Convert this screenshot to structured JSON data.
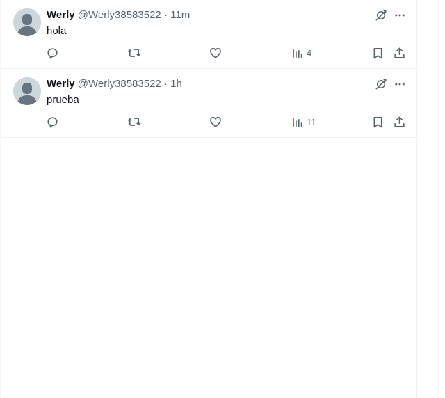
{
  "posts": [
    {
      "author_name": "Werly",
      "author_handle": "@Werly38583522",
      "separator": "·",
      "time": "11m",
      "text": "hola",
      "views_count": "4",
      "icons": {
        "avatar": "default-avatar",
        "grok": "grok-icon",
        "more": "more-icon",
        "reply": "reply-icon",
        "repost": "repost-icon",
        "like": "heart-icon",
        "views": "bar-chart-icon",
        "bookmark": "bookmark-icon",
        "share": "share-icon"
      }
    },
    {
      "author_name": "Werly",
      "author_handle": "@Werly38583522",
      "separator": "·",
      "time": "1h",
      "text": "prueba",
      "views_count": "11",
      "icons": {
        "avatar": "default-avatar",
        "grok": "grok-icon",
        "more": "more-icon",
        "reply": "reply-icon",
        "repost": "repost-icon",
        "like": "heart-icon",
        "views": "bar-chart-icon",
        "bookmark": "bookmark-icon",
        "share": "share-icon"
      }
    }
  ],
  "colors": {
    "text_primary": "#0f1419",
    "text_secondary": "#536471",
    "border": "#eff3f4",
    "avatar_bg": "#ccd6dd"
  }
}
